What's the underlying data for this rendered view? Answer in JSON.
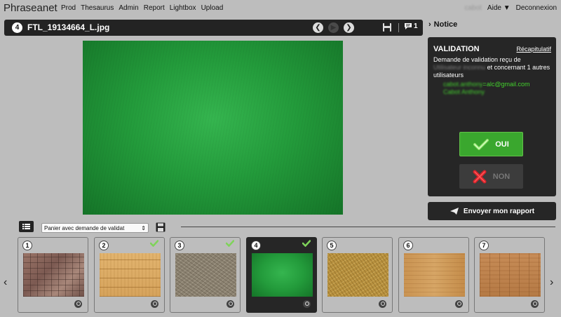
{
  "app": {
    "name": "Phraseanet"
  },
  "nav": [
    "Prod",
    "Thesaurus",
    "Admin",
    "Report",
    "Lightbox",
    "Upload"
  ],
  "user": {
    "name": "cabot",
    "help": "Aide ▼",
    "logout": "Deconnexion"
  },
  "document": {
    "index": "4",
    "title": "FTL_19134664_L.jpg",
    "comment_count": "1"
  },
  "notice": {
    "title": "Notice"
  },
  "validation": {
    "title": "VALIDATION",
    "recap_link": "Récapitulatif",
    "text_1": "Demande de validation reçu de",
    "text_user": "Utilisateur inconnu",
    "text_2": "et concernant 1 autres utilisateurs",
    "email_user": "cabot.anthony",
    "email_domain": "alc@gmail.com",
    "contact_name": "Cabot Anthony",
    "yes_label": "OUI",
    "no_label": "NON"
  },
  "report_button": "Envoyer mon rapport",
  "basket": {
    "selected": "Panier avec demande de validat"
  },
  "thumbnails": [
    {
      "num": "1",
      "validated": false,
      "active": false
    },
    {
      "num": "2",
      "validated": true,
      "active": false
    },
    {
      "num": "3",
      "validated": true,
      "active": false
    },
    {
      "num": "4",
      "validated": true,
      "active": true
    },
    {
      "num": "5",
      "validated": false,
      "active": false
    },
    {
      "num": "6",
      "validated": false,
      "active": false
    },
    {
      "num": "7",
      "validated": false,
      "active": false
    }
  ],
  "colors": {
    "accent_green": "#3aa72e",
    "panel_dark": "#262626",
    "email_green": "#43d02d"
  },
  "icons": {
    "prev": "chevron-left-icon",
    "next": "chevron-right-icon",
    "play": "play-icon",
    "save": "floppy-disk-icon",
    "comment": "speech-bubble-icon",
    "check": "checkmark-icon",
    "cross": "cross-icon",
    "send": "paper-plane-icon",
    "zoom": "magnifier-icon",
    "list": "list-icon"
  }
}
